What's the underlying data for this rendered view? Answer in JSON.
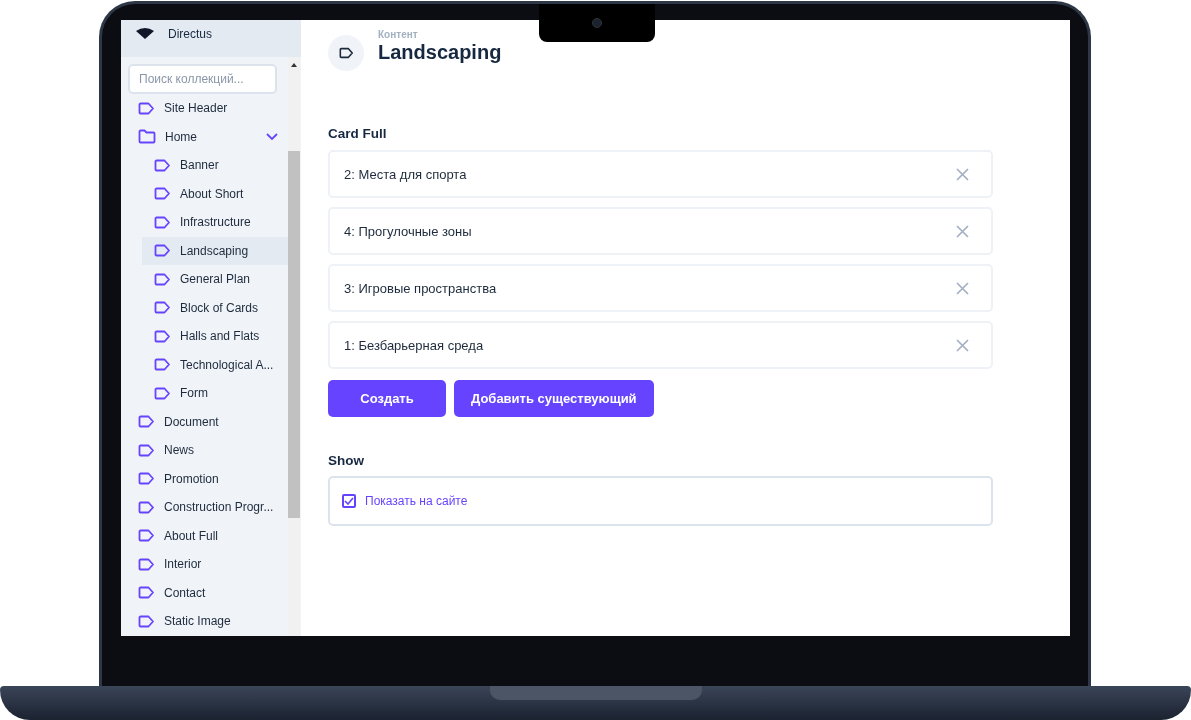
{
  "sidebar": {
    "brand": "Directus",
    "search": {
      "placeholder": "Поиск коллекций..."
    },
    "items": [
      {
        "label": "Site Header",
        "kind": "collection",
        "selected": false
      },
      {
        "label": "Home",
        "kind": "folder",
        "expanded": true,
        "selected": false,
        "children": [
          {
            "label": "Banner",
            "kind": "collection",
            "selected": false
          },
          {
            "label": "About Short",
            "kind": "collection",
            "selected": false
          },
          {
            "label": "Infrastructure",
            "kind": "collection",
            "selected": false
          },
          {
            "label": "Landscaping",
            "kind": "collection",
            "selected": true
          },
          {
            "label": "General Plan",
            "kind": "collection",
            "selected": false
          },
          {
            "label": "Block of Cards",
            "kind": "collection",
            "selected": false
          },
          {
            "label": "Halls and Flats",
            "kind": "collection",
            "selected": false
          },
          {
            "label": "Technological A...",
            "kind": "collection",
            "selected": false
          },
          {
            "label": "Form",
            "kind": "collection",
            "selected": false
          }
        ]
      },
      {
        "label": "Document",
        "kind": "collection",
        "selected": false
      },
      {
        "label": "News",
        "kind": "collection",
        "selected": false
      },
      {
        "label": "Promotion",
        "kind": "collection",
        "selected": false
      },
      {
        "label": "Construction Progr...",
        "kind": "collection",
        "selected": false
      },
      {
        "label": "About Full",
        "kind": "collection",
        "selected": false
      },
      {
        "label": "Interior",
        "kind": "collection",
        "selected": false
      },
      {
        "label": "Contact",
        "kind": "collection",
        "selected": false
      },
      {
        "label": "Static Image",
        "kind": "collection",
        "selected": false
      }
    ]
  },
  "header": {
    "breadcrumb": "Контент",
    "title": "Landscaping"
  },
  "card_full": {
    "label": "Card Full",
    "items": [
      "2: Места для спорта",
      "4: Прогулочные зоны",
      "3: Игровые пространства",
      "1: Безбарьерная среда"
    ],
    "buttons": [
      "Создать",
      "Добавить существующий"
    ]
  },
  "show": {
    "label": "Show",
    "checkbox": {
      "label": "Показать на сайте",
      "checked": true
    }
  }
}
